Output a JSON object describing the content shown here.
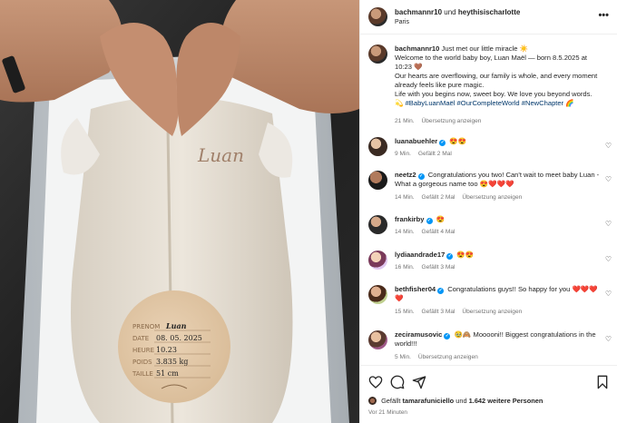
{
  "post": {
    "author_primary": "bachmannr10",
    "author_joiner": "und",
    "author_secondary": "heythisischarlotte",
    "location": "Paris"
  },
  "photo": {
    "garment_text": "Luan",
    "card": {
      "rows": [
        {
          "label": "PRENOM",
          "value": "Luan"
        },
        {
          "label": "DATE",
          "value": "08. 05. 2025"
        },
        {
          "label": "HEURE",
          "value": "10.23"
        },
        {
          "label": "POIDS",
          "value": "3.835 kg"
        },
        {
          "label": "TAILLE",
          "value": "51 cm"
        }
      ]
    }
  },
  "caption": {
    "user": "bachmannr10",
    "line1": "Just met our little miracle ☀️",
    "line2": "Welcome to the world baby boy, Luan Maël — born 8.5.2025 at 10:23 🤎",
    "line3": "Our hearts are overflowing, our family is whole, and every moment already feels like pure magic.",
    "line4": "Life with you begins now, sweet boy. We love you beyond words.",
    "hashtags": "💫 #BabyLuanMaël #OurCompleteWorld #NewChapter 🌈",
    "time": "21 Min.",
    "translate": "Übersetzung anzeigen"
  },
  "comments": [
    {
      "user": "luanabuehler",
      "verified": true,
      "text": "😍😍",
      "time": "9 Min.",
      "likes": "Gefällt 2 Mal",
      "translate": ""
    },
    {
      "user": "neetz2",
      "verified": true,
      "text": "Congratulations you two! Can't wait to meet baby Luan - What a gorgeous name too 😍❤️❤️❤️",
      "time": "14 Min.",
      "likes": "Gefällt 2 Mal",
      "translate": "Übersetzung anzeigen"
    },
    {
      "user": "frankirby",
      "verified": true,
      "text": "😍",
      "time": "14 Min.",
      "likes": "Gefällt 4 Mal",
      "translate": ""
    },
    {
      "user": "lydiaandrade17",
      "verified": true,
      "text": "😍😍",
      "time": "16 Min.",
      "likes": "Gefällt 3 Mal",
      "translate": ""
    },
    {
      "user": "bethfisher04",
      "verified": true,
      "text": "Congratulations guys!! So happy for you ❤️❤️❤️❤️",
      "time": "15 Min.",
      "likes": "Gefällt 3 Mal",
      "translate": "Übersetzung anzeigen"
    },
    {
      "user": "zeciramusovic",
      "verified": true,
      "text": "🥹🙈 Mooooni!! Biggest congratulations in the world!!!",
      "time": "5 Min.",
      "likes": "",
      "translate": "Übersetzung anzeigen"
    }
  ],
  "footer": {
    "likes_prefix": "Gefällt",
    "likes_user": "tamarafuniciello",
    "likes_mid": "und",
    "likes_count": "1.642 weitere Personen",
    "timestamp": "Vor 21 Minuten"
  },
  "icons": {
    "like": "heart-icon",
    "comment": "comment-icon",
    "share": "share-icon",
    "save": "bookmark-icon",
    "more": "more-icon",
    "verified": "verified-badge-icon"
  },
  "colors": {
    "link": "#00376b",
    "verified": "#0095f6",
    "meta": "#737373",
    "divider": "#efefef"
  }
}
